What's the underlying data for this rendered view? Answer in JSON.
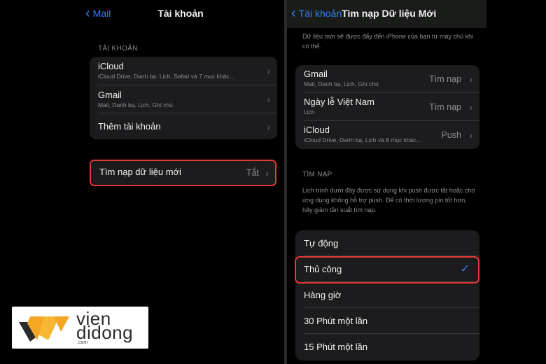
{
  "left": {
    "back_label": "Mail",
    "title": "Tài khoản",
    "section_label": "TÀI KHOẢN",
    "accounts": [
      {
        "title": "iCloud",
        "sub": "iCloud Drive, Danh bạ, Lịch, Safari và 7 mục khác..."
      },
      {
        "title": "Gmail",
        "sub": "Mail, Danh bạ, Lịch, Ghi chú"
      },
      {
        "title": "Thêm tài khoản",
        "sub": ""
      }
    ],
    "fetch_label": "Tìm nạp dữ liệu mới",
    "fetch_value": "Tắt"
  },
  "right": {
    "back_label": "Tài khoản",
    "title": "Tìm nạp Dữ liệu Mới",
    "intro": "Dữ liệu mới sẽ được đẩy đến iPhone của bạn từ máy chủ khi có thể.",
    "accounts": [
      {
        "title": "Gmail",
        "sub": "Mail, Danh bạ, Lịch, Ghi chú",
        "value": "Tìm nạp"
      },
      {
        "title": "Ngày lễ Việt Nam",
        "sub": "Lịch",
        "value": "Tìm nạp"
      },
      {
        "title": "iCloud",
        "sub": "iCloud Drive, Danh bạ, Lịch và 8 mục khác...",
        "value": "Push"
      }
    ],
    "fetch_section_label": "TÌM NẠP",
    "fetch_note": "Lịch trình dưới đây được sử dụng khi push được tắt hoặc cho ứng dụng không hỗ trợ push. Để có thời lượng pin tốt hơn, hãy giảm tần suất tìm nạp.",
    "options": [
      {
        "label": "Tự động",
        "selected": false
      },
      {
        "label": "Thủ công",
        "selected": true
      },
      {
        "label": "Hàng giờ",
        "selected": false
      },
      {
        "label": "30 Phút một lần",
        "selected": false
      },
      {
        "label": "15 Phút một lần",
        "selected": false
      }
    ]
  },
  "logo": {
    "line1": "vien",
    "line2": "didong",
    "line3": ".com"
  },
  "colors": {
    "accent": "#2f7ff0",
    "highlight": "#e53935",
    "logo_orange": "#f5a623"
  },
  "icons": {
    "back": "chevron-left-icon",
    "disclosure": "chevron-right-icon",
    "selected": "checkmark-icon"
  }
}
